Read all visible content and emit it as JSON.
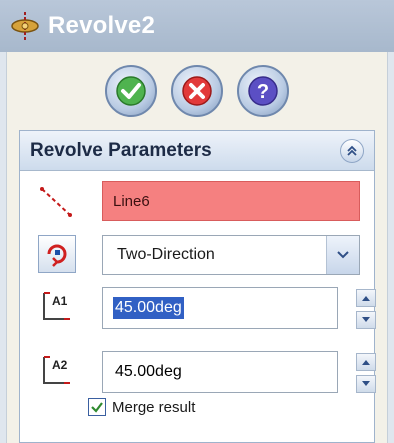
{
  "window": {
    "title": "Revolve2",
    "icons": {
      "title": "revolve-feature-icon"
    }
  },
  "actions": [
    {
      "name": "ok",
      "icon": "green-check-icon"
    },
    {
      "name": "cancel",
      "icon": "red-x-icon"
    },
    {
      "name": "help",
      "icon": "question-icon"
    }
  ],
  "revolve_parameters": {
    "header": "Revolve Parameters",
    "axis_selection": "Line6",
    "direction_type": "Two-Direction",
    "angle1": {
      "label": "A1",
      "value": "45.00deg"
    },
    "angle2": {
      "label": "A2",
      "value": "45.00deg"
    }
  },
  "merge_result": {
    "label": "Merge result",
    "checked": true
  },
  "colors": {
    "title_bar": "#a7b8cc",
    "selection_box": "#f58080",
    "selected_text_bg": "#3160c4"
  }
}
